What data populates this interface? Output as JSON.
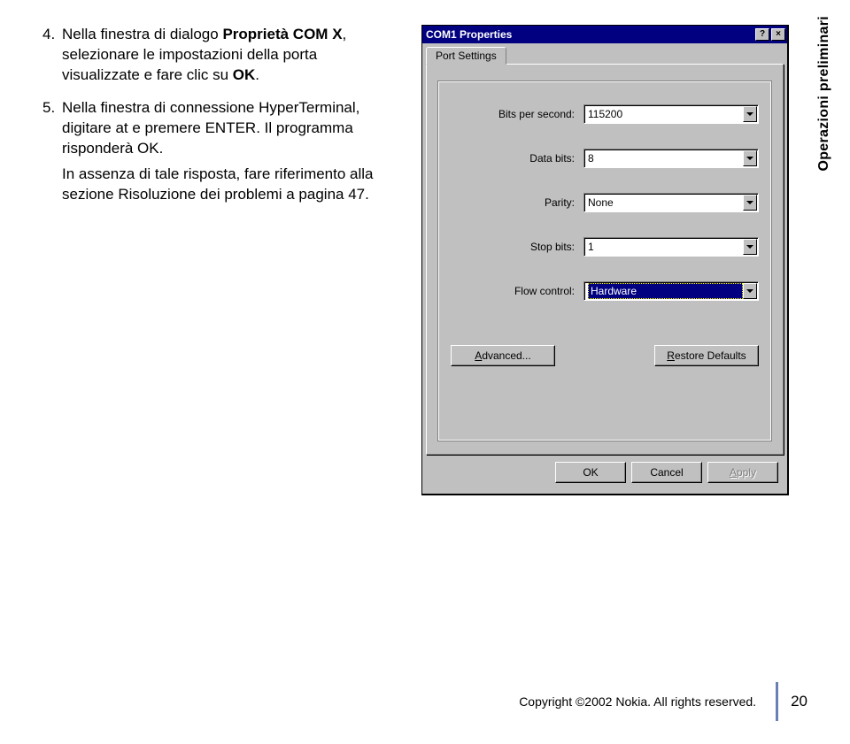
{
  "instructions": {
    "step4_num": "4.",
    "step4_prefix": "Nella finestra di dialogo ",
    "step4_bold": "Proprietà COM X",
    "step4_rest": ", selezionare le impostazioni della porta visualizzate e fare clic su ",
    "step4_ok": "OK",
    "step4_end": ".",
    "step5_num": "5.",
    "step5_text": "Nella finestra di connessione HyperTerminal, digitare at e premere ENTER. Il programma risponderà OK.",
    "step5_after": "In assenza di tale risposta, fare riferimento alla sezione Risoluzione dei problemi a pagina 47."
  },
  "dialog": {
    "title": "COM1 Properties",
    "help_icon": "?",
    "close_icon": "×",
    "tab": "Port Settings",
    "fields": {
      "bps_label": "Bits per second:",
      "bps_value": "115200",
      "databits_label": "Data bits:",
      "databits_value": "8",
      "parity_label": "Parity:",
      "parity_value": "None",
      "stopbits_label": "Stop bits:",
      "stopbits_value": "1",
      "flow_label": "Flow control:",
      "flow_value": "Hardware"
    },
    "buttons": {
      "advanced": "Advanced...",
      "restore": "Restore Defaults",
      "ok": "OK",
      "cancel": "Cancel",
      "apply": "Apply"
    }
  },
  "side_label": "Operazioni preliminari",
  "footer": {
    "copyright": "Copyright ©2002 Nokia. All rights reserved.",
    "page": "20"
  }
}
